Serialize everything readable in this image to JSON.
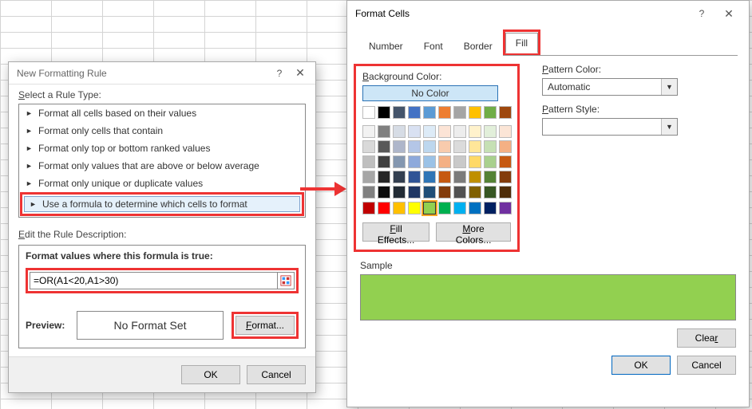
{
  "dialog1": {
    "title": "New Formatting Rule",
    "select_label_pre": "S",
    "select_label_rest": "elect a Rule Type:",
    "rules": [
      "Format all cells based on their values",
      "Format only cells that contain",
      "Format only top or bottom ranked values",
      "Format only values that are above or below average",
      "Format only unique or duplicate values",
      "Use a formula to determine which cells to format"
    ],
    "edit_label_pre": "E",
    "edit_label_rest": "dit the Rule Description:",
    "formula_label": "Format values where this formula is true:",
    "formula_value": "=OR(A1<20,A1>30)",
    "preview_label": "Preview:",
    "preview_text": "No Format Set",
    "format_btn": "Format...",
    "ok": "OK",
    "cancel": "Cancel"
  },
  "dialog2": {
    "title": "Format Cells",
    "tabs": {
      "number": "Number",
      "font": "Font",
      "border": "Border",
      "fill": "Fill"
    },
    "bg_label": "Background Color:",
    "no_color": "No Color",
    "fill_effects": "Fill Effects...",
    "more_colors": "More Colors...",
    "pattern_color_label": "Pattern Color:",
    "pattern_color_value": "Automatic",
    "pattern_style_label": "Pattern Style:",
    "sample_label": "Sample",
    "clear": "Clear",
    "ok": "OK",
    "cancel": "Cancel",
    "theme_colors_row1": [
      "#ffffff",
      "#000000",
      "#44546a",
      "#4472c4",
      "#5b9bd5",
      "#ed7d31",
      "#a5a5a5",
      "#ffc000",
      "#70ad47",
      "#9e480e"
    ],
    "theme_colors_tints": [
      [
        "#f2f2f2",
        "#808080",
        "#d6dce5",
        "#d9e1f2",
        "#ddebf7",
        "#fce4d6",
        "#ededed",
        "#fff2cc",
        "#e2efda",
        "#fbe5d6"
      ],
      [
        "#d9d9d9",
        "#595959",
        "#aeb6ca",
        "#b4c6e7",
        "#bdd7ee",
        "#f8cbad",
        "#dbdbdb",
        "#ffe699",
        "#c6e0b4",
        "#f4b084"
      ],
      [
        "#bfbfbf",
        "#404040",
        "#8497b0",
        "#8ea9db",
        "#9bc2e6",
        "#f4b084",
        "#c9c9c9",
        "#ffd966",
        "#a9d08e",
        "#c65911"
      ],
      [
        "#a6a6a6",
        "#262626",
        "#333f50",
        "#305496",
        "#2e75b6",
        "#c65911",
        "#7b7b7b",
        "#bf8f00",
        "#548235",
        "#833c0c"
      ],
      [
        "#808080",
        "#0d0d0d",
        "#222b35",
        "#203764",
        "#1f4e78",
        "#833c0c",
        "#525252",
        "#806000",
        "#375623",
        "#4f2d09"
      ]
    ],
    "standard_colors": [
      "#c00000",
      "#ff0000",
      "#ffc000",
      "#ffff00",
      "#92d050",
      "#00b050",
      "#00b0f0",
      "#0070c0",
      "#002060",
      "#7030a0"
    ],
    "selected_color": "#92d050",
    "sample_fill": "#92d050"
  }
}
